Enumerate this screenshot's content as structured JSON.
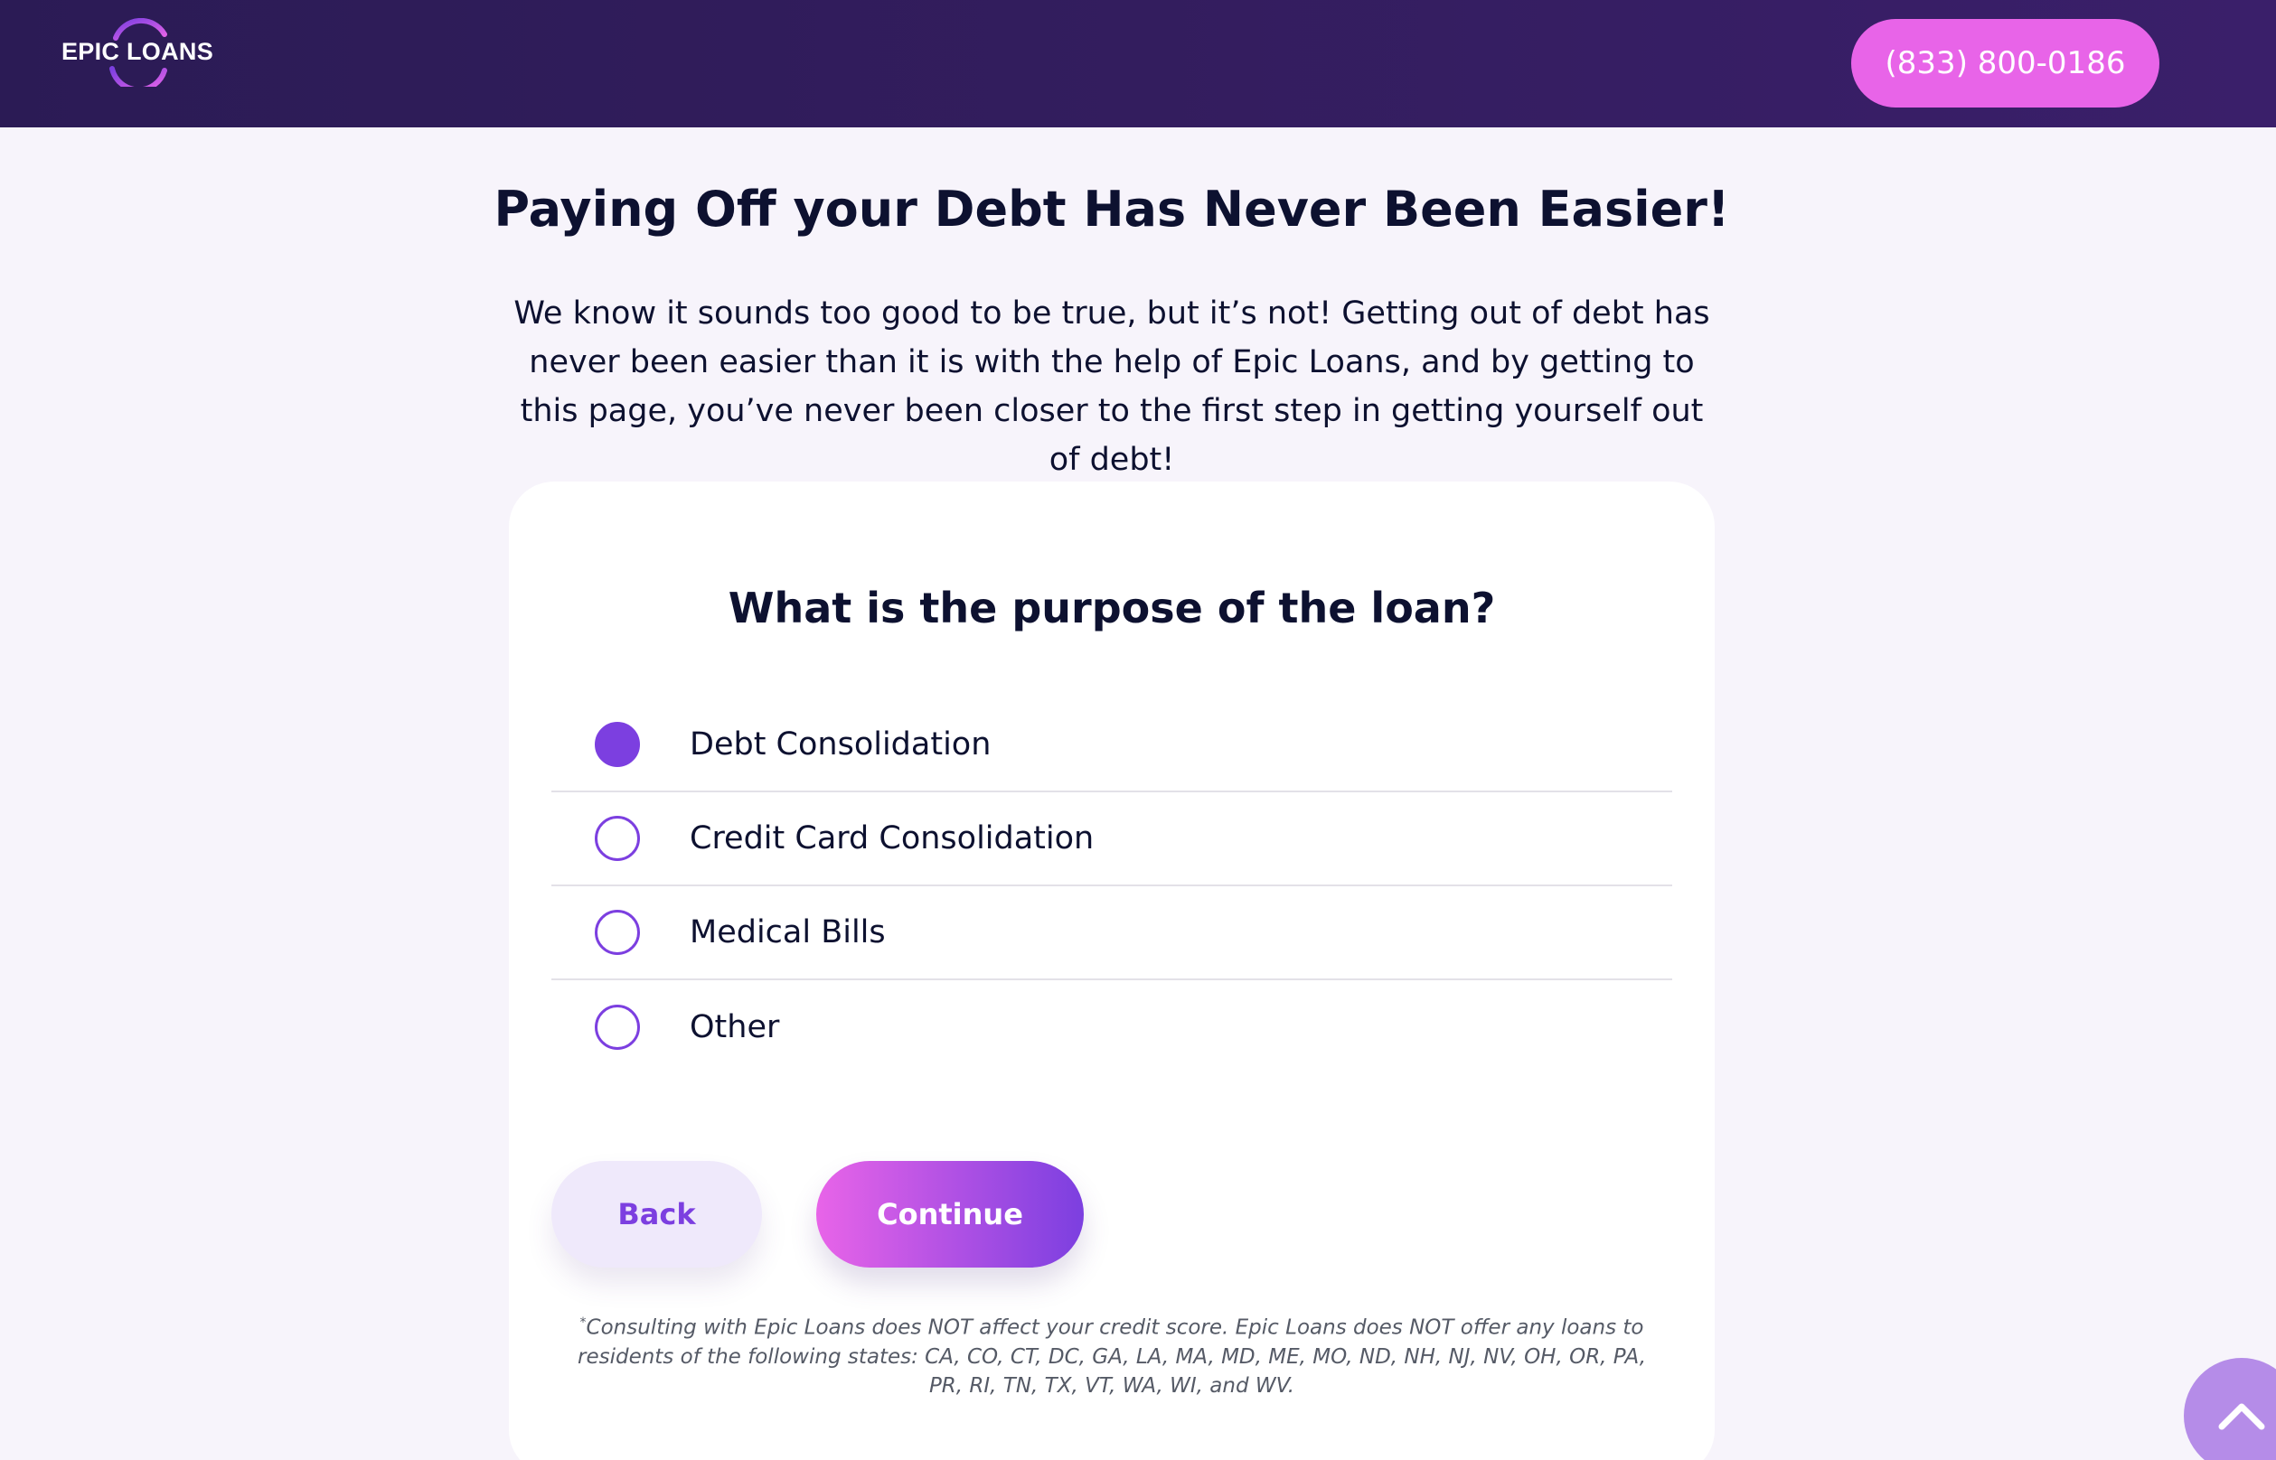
{
  "header": {
    "logo_text": "EPIC LOANS",
    "phone_label": "(833) 800-0186"
  },
  "main": {
    "title": "Paying Off your Debt Has Never Been Easier!",
    "intro": "We know it sounds too good to be true, but it’s not! Getting out of debt has never been easier than it is with the help of Epic Loans, and by getting to this page, you’ve never been closer to the first step in getting yourself out of debt!"
  },
  "form": {
    "question": "What is the purpose of the loan?",
    "options": [
      {
        "label": "Debt Consolidation",
        "selected": true
      },
      {
        "label": "Credit Card Consolidation",
        "selected": false
      },
      {
        "label": "Medical Bills",
        "selected": false
      },
      {
        "label": "Other",
        "selected": false
      }
    ],
    "back_label": "Back",
    "continue_label": "Continue"
  },
  "disclaimer": {
    "marker": "*",
    "text": "Consulting with Epic Loans does NOT affect your credit score. Epic Loans does NOT offer any loans to residents of the following states: CA, CO, CT, DC, GA, LA, MA, MD, ME, MO, ND, NH, NJ, NV, OH, OR, PA, PR, RI, TN, TX, VT, WA, WI, and WV."
  },
  "colors": {
    "header_bg": "#2b1b55",
    "accent_pink": "#e864e8",
    "accent_purple": "#7c3fe0",
    "page_bg": "#f7f4fb"
  },
  "icons": {
    "logo": "epic-loans-swoosh-logo",
    "scroll_top": "chevron-up-icon"
  }
}
